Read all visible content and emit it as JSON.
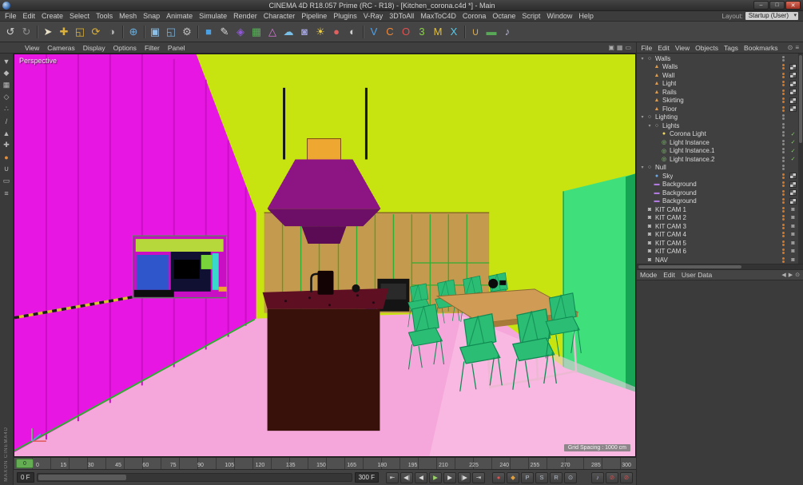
{
  "window": {
    "title": "CINEMA 4D R18.057 Prime (RC - R18) - [Kitchen_corona.c4d *] - Main",
    "controls": [
      {
        "name": "minimize-button",
        "glyph": "–"
      },
      {
        "name": "maximize-button",
        "glyph": "□"
      },
      {
        "name": "close-button",
        "glyph": "✕"
      }
    ]
  },
  "menubar": {
    "items": [
      "File",
      "Edit",
      "Create",
      "Select",
      "Tools",
      "Mesh",
      "Snap",
      "Animate",
      "Simulate",
      "Render",
      "Character",
      "Pipeline",
      "Plugins",
      "V-Ray",
      "3DToAll",
      "MaxToC4D",
      "Corona",
      "Octane",
      "Script",
      "Window",
      "Help"
    ],
    "layout_label": "Layout:",
    "layout_value": "Startup (User)"
  },
  "toolbar": {
    "icons": [
      {
        "name": "undo-icon",
        "glyph": "↺",
        "color": "#d0d0d0"
      },
      {
        "name": "redo-icon",
        "glyph": "↻",
        "color": "#909090"
      },
      {
        "type": "sep"
      },
      {
        "name": "live-selection-icon",
        "glyph": "➤",
        "color": "#e8e0c8"
      },
      {
        "name": "move-tool-icon",
        "glyph": "✚",
        "color": "#dcb23c"
      },
      {
        "name": "scale-tool-icon",
        "glyph": "◱",
        "color": "#dcb23c"
      },
      {
        "name": "rotate-tool-icon",
        "glyph": "⟳",
        "color": "#dcb23c"
      },
      {
        "name": "last-tool-icon",
        "glyph": "◑",
        "color": "#b0b0b0"
      },
      {
        "type": "sep"
      },
      {
        "name": "coordinate-system-icon",
        "glyph": "⊕",
        "color": "#6ab0e0"
      },
      {
        "type": "sep"
      },
      {
        "name": "render-view-icon",
        "glyph": "▣",
        "color": "#8cc0e8"
      },
      {
        "name": "render-region-icon",
        "glyph": "◱",
        "color": "#7ab0d8"
      },
      {
        "name": "render-settings-icon",
        "glyph": "⚙",
        "color": "#c0c0c0"
      },
      {
        "type": "sep"
      },
      {
        "name": "add-cube-icon",
        "glyph": "■",
        "color": "#4aa0e0"
      },
      {
        "name": "add-spline-icon",
        "glyph": "✎",
        "color": "#d8d8d8"
      },
      {
        "name": "subdivision-surface-icon",
        "glyph": "◈",
        "color": "#9058d8"
      },
      {
        "name": "array-modifier-icon",
        "glyph": "▦",
        "color": "#58b058"
      },
      {
        "name": "deformer-icon",
        "glyph": "△",
        "color": "#d878d8"
      },
      {
        "name": "environment-icon",
        "glyph": "☁",
        "color": "#78c0e8"
      },
      {
        "name": "camera-object-icon",
        "glyph": "◙",
        "color": "#a0a0d8"
      },
      {
        "name": "light-object-icon",
        "glyph": "☀",
        "color": "#f0d048"
      },
      {
        "name": "material-icon",
        "glyph": "●",
        "color": "#e06060"
      },
      {
        "name": "shader-icon",
        "glyph": "◐",
        "color": "#d0d0d0"
      },
      {
        "type": "sep"
      },
      {
        "name": "vray-plugin-icon",
        "glyph": "V",
        "color": "#50a0e8"
      },
      {
        "name": "corona-plugin-icon",
        "glyph": "C",
        "color": "#f08838"
      },
      {
        "name": "octane-plugin-icon",
        "glyph": "O",
        "color": "#e05050"
      },
      {
        "name": "threedtoall-plugin-icon",
        "glyph": "3",
        "color": "#8ad048"
      },
      {
        "name": "maxtoc4d-plugin-icon",
        "glyph": "M",
        "color": "#e0c040"
      },
      {
        "name": "xparticles-plugin-icon",
        "glyph": "X",
        "color": "#58c8e8"
      },
      {
        "type": "sep"
      },
      {
        "name": "snap-toggle-icon",
        "glyph": "∪",
        "color": "#d0a858"
      },
      {
        "name": "workplane-icon",
        "glyph": "▬",
        "color": "#58a858"
      },
      {
        "name": "sound-icon",
        "glyph": "♪",
        "color": "#b8b8d8"
      }
    ]
  },
  "viewport": {
    "menus": [
      "View",
      "Cameras",
      "Display",
      "Options",
      "Filter",
      "Panel"
    ],
    "corner_icons": [
      {
        "name": "view-hud-icon",
        "glyph": "▣"
      },
      {
        "name": "view-layout-icon",
        "glyph": "▦"
      },
      {
        "name": "view-maximize-icon",
        "glyph": "▭"
      }
    ],
    "label": "Perspective",
    "grid_hint": "Grid Spacing : 1000 cm"
  },
  "left_palette": {
    "icons": [
      {
        "name": "make-editable-icon",
        "glyph": "▼",
        "color": "#b8b8b8"
      },
      {
        "name": "model-mode-icon",
        "glyph": "◆",
        "color": "#b8b8b8"
      },
      {
        "name": "texture-mode-icon",
        "glyph": "▦",
        "color": "#b8b8b8"
      },
      {
        "name": "workplane-mode-icon",
        "glyph": "◇",
        "color": "#b8b8b8"
      },
      {
        "name": "points-mode-icon",
        "glyph": "∴",
        "color": "#b8b8b8"
      },
      {
        "name": "edges-mode-icon",
        "glyph": "/",
        "color": "#b8b8b8"
      },
      {
        "name": "polygons-mode-icon",
        "glyph": "▲",
        "color": "#b8b8b8"
      },
      {
        "name": "enable-axis-icon",
        "glyph": "✚",
        "color": "#b8b8b8"
      },
      {
        "name": "viewport-solo-icon",
        "glyph": "●",
        "color": "#e09040"
      },
      {
        "name": "enable-snap-icon",
        "glyph": "∪",
        "color": "#b8b8b8"
      },
      {
        "name": "workplane-lock-icon",
        "glyph": "▭",
        "color": "#b8b8b8"
      },
      {
        "name": "quantize-icon",
        "glyph": "≡",
        "color": "#b8b8b8"
      }
    ],
    "watermark": "MAXON CINEMA4D"
  },
  "object_manager": {
    "menus": [
      "File",
      "Edit",
      "View",
      "Objects",
      "Tags",
      "Bookmarks"
    ],
    "icons": [
      {
        "name": "search-icon",
        "glyph": "⊙"
      },
      {
        "name": "filter-icon",
        "glyph": "≡"
      }
    ],
    "items": [
      {
        "label": "Walls",
        "depth": 0,
        "icon": "null",
        "arrow": "exp",
        "tag": "none",
        "dots": "gray"
      },
      {
        "label": "Walls",
        "depth": 1,
        "icon": "poly",
        "arrow": "none",
        "tag": "mat",
        "dots": "orange"
      },
      {
        "label": "Wall",
        "depth": 1,
        "icon": "poly",
        "arrow": "none",
        "tag": "mat",
        "dots": "orange"
      },
      {
        "label": "Light",
        "depth": 1,
        "icon": "poly",
        "arrow": "none",
        "tag": "mat",
        "dots": "orange"
      },
      {
        "label": "Rails",
        "depth": 1,
        "icon": "poly",
        "arrow": "none",
        "tag": "mat",
        "dots": "orange"
      },
      {
        "label": "Skirting",
        "depth": 1,
        "icon": "poly",
        "arrow": "none",
        "tag": "mat",
        "dots": "orange"
      },
      {
        "label": "Floor",
        "depth": 1,
        "icon": "poly",
        "arrow": "none",
        "tag": "mat",
        "dots": "orange"
      },
      {
        "label": "Lighting",
        "depth": 0,
        "icon": "null",
        "arrow": "exp",
        "tag": "none",
        "dots": "gray"
      },
      {
        "label": "Lights",
        "depth": 1,
        "icon": "null",
        "arrow": "exp",
        "tag": "none",
        "dots": "gray"
      },
      {
        "label": "Corona Light",
        "depth": 2,
        "icon": "light",
        "arrow": "none",
        "tag": "check",
        "dots": "gray"
      },
      {
        "label": "Light Instance",
        "depth": 2,
        "icon": "instance",
        "arrow": "none",
        "tag": "check",
        "dots": "gray"
      },
      {
        "label": "Light Instance.1",
        "depth": 2,
        "icon": "instance",
        "arrow": "none",
        "tag": "check",
        "dots": "gray"
      },
      {
        "label": "Light Instance.2",
        "depth": 2,
        "icon": "instance",
        "arrow": "none",
        "tag": "check",
        "dots": "gray"
      },
      {
        "label": "Null",
        "depth": 0,
        "icon": "null",
        "arrow": "exp",
        "tag": "none",
        "dots": "gray"
      },
      {
        "label": "Sky",
        "depth": 1,
        "icon": "sky",
        "arrow": "none",
        "tag": "mat",
        "dots": "orange"
      },
      {
        "label": "Background",
        "depth": 1,
        "icon": "bg",
        "arrow": "none",
        "tag": "mat",
        "dots": "orange"
      },
      {
        "label": "Background",
        "depth": 1,
        "icon": "bg",
        "arrow": "none",
        "tag": "mat",
        "dots": "orange"
      },
      {
        "label": "Background",
        "depth": 1,
        "icon": "bg",
        "arrow": "none",
        "tag": "mat",
        "dots": "orange"
      },
      {
        "label": "KIT CAM 1",
        "depth": 0,
        "icon": "camera",
        "arrow": "none",
        "tag": "cam",
        "dots": "orange"
      },
      {
        "label": "KIT CAM 2",
        "depth": 0,
        "icon": "camera",
        "arrow": "none",
        "tag": "cam",
        "dots": "orange"
      },
      {
        "label": "KIT CAM 3",
        "depth": 0,
        "icon": "camera",
        "arrow": "none",
        "tag": "cam",
        "dots": "orange"
      },
      {
        "label": "KIT CAM 4",
        "depth": 0,
        "icon": "camera",
        "arrow": "none",
        "tag": "cam",
        "dots": "orange"
      },
      {
        "label": "KIT CAM 5",
        "depth": 0,
        "icon": "camera",
        "arrow": "none",
        "tag": "cam",
        "dots": "orange"
      },
      {
        "label": "KIT CAM 6",
        "depth": 0,
        "icon": "camera",
        "arrow": "none",
        "tag": "cam",
        "dots": "orange"
      },
      {
        "label": "NAV",
        "depth": 0,
        "icon": "camera",
        "arrow": "none",
        "tag": "cam",
        "dots": "orange"
      }
    ]
  },
  "attribute_manager": {
    "menus": [
      "Mode",
      "Edit",
      "User Data"
    ],
    "icons": [
      {
        "name": "history-back-icon",
        "glyph": "◀"
      },
      {
        "name": "history-forward-icon",
        "glyph": "▶"
      },
      {
        "name": "lock-icon",
        "glyph": "⊙"
      }
    ]
  },
  "timeline": {
    "current_frame": "0",
    "ticks": [
      "0",
      "15",
      "30",
      "45",
      "60",
      "75",
      "90",
      "105",
      "120",
      "135",
      "150",
      "165",
      "180",
      "195",
      "210",
      "225",
      "240",
      "255",
      "270",
      "285",
      "300"
    ]
  },
  "transport": {
    "frame_start": "0 F",
    "frame_end": "300 F",
    "buttons": [
      {
        "name": "goto-start-button",
        "glyph": "⇤"
      },
      {
        "name": "prev-key-button",
        "glyph": "◀|"
      },
      {
        "name": "prev-frame-button",
        "glyph": "◀"
      },
      {
        "name": "play-button",
        "glyph": "▶",
        "color": "#9ad36a"
      },
      {
        "name": "next-frame-button",
        "glyph": "▶"
      },
      {
        "name": "next-key-button",
        "glyph": "|▶"
      },
      {
        "name": "goto-end-button",
        "glyph": "⇥"
      }
    ],
    "record": [
      {
        "name": "record-keyframe-button",
        "glyph": "●",
        "color": "#e05050"
      },
      {
        "name": "autokey-button",
        "glyph": "◆",
        "color": "#e0a040"
      },
      {
        "name": "record-position-button",
        "glyph": "P",
        "color": "#b8c0cc"
      },
      {
        "name": "record-scale-button",
        "glyph": "S",
        "color": "#b8c0cc"
      },
      {
        "name": "record-rotation-button",
        "glyph": "R",
        "color": "#b8c0cc"
      },
      {
        "name": "record-params-button",
        "glyph": "⊙",
        "color": "#b8c0cc"
      }
    ],
    "right_icons": [
      {
        "name": "sound-toggle-button",
        "glyph": "♪",
        "color": "#b8b8d8"
      },
      {
        "name": "render-lock-button",
        "glyph": "⊘",
        "color": "#d85050"
      },
      {
        "name": "render-abort-button",
        "glyph": "⊘",
        "color": "#d85050"
      }
    ]
  },
  "scene": {
    "colors": {
      "ceiling": "#c7e410",
      "wall_left": "#e816e2",
      "wall_left_dark": "#c90fc4",
      "floor": "#f5a6da",
      "floor_light": "#f9c6e8",
      "wall_right": "#3fe07c",
      "wall_right_dark": "#17a455",
      "cabinet": "#c49a4e",
      "island": "#38120a",
      "counter": "#5e0f22",
      "hood": "#8c1483",
      "hood_box": "#eea832",
      "chair": "#2cbd74",
      "table": "#cf9b55",
      "blue_bin": "#2b3fc1",
      "tv_dark": "#101033",
      "win_green": "#78d23a",
      "win_blue": "#3056cc",
      "win_cyan": "#38d8cc"
    }
  }
}
